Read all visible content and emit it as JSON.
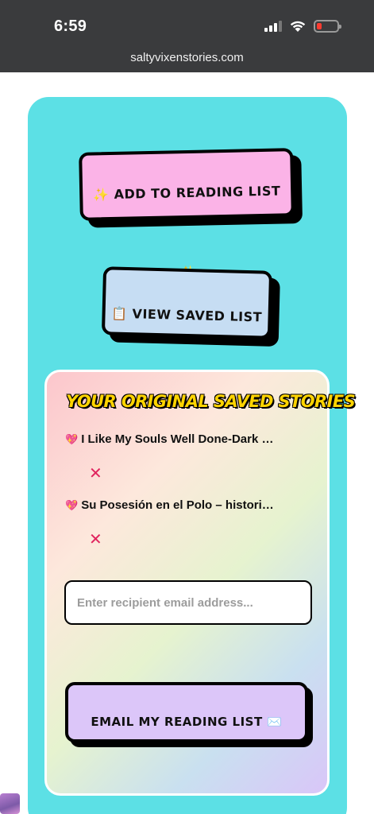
{
  "status_bar": {
    "time": "6:59"
  },
  "browser": {
    "url": "saltyvixenstories.com"
  },
  "buttons": {
    "add_to_list": "✨ ADD TO READING LIST ✨",
    "view_saved": "📋 VIEW SAVED LIST"
  },
  "saved_panel": {
    "title": "YOUR ORIGINAL SAVED STORIES",
    "stories": [
      {
        "heart": "💖",
        "title": "I Like My Souls Well Done-Dark …",
        "remove": "✕"
      },
      {
        "heart": "💖",
        "title": "Su Posesión en el Polo – histori…",
        "remove": "✕"
      }
    ],
    "email_placeholder": "Enter recipient email address...",
    "email_button": "EMAIL MY READING LIST ✉️"
  },
  "colors": {
    "card_bg": "#5ce0e5",
    "add_button": "#fbb3e7",
    "view_button": "#c6ddf3",
    "email_button": "#dcc6f9",
    "title_yellow": "#ffd400"
  }
}
